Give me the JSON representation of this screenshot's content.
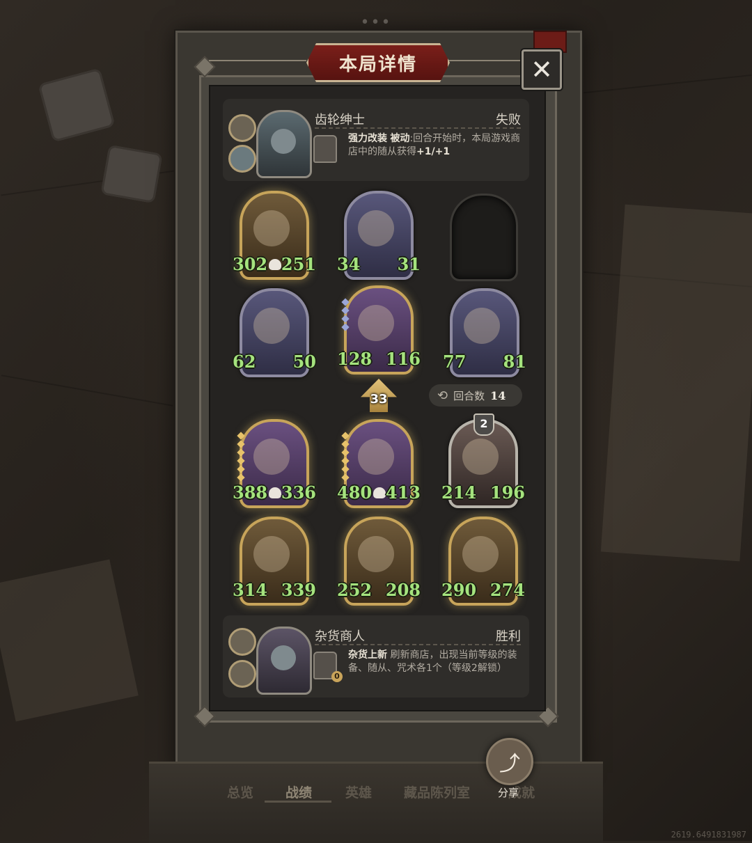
{
  "dialog": {
    "title": "本局详情",
    "close_label": "✕"
  },
  "opponent": {
    "name": "齿轮绅士",
    "result": "失败",
    "skill_name": "强力改装",
    "skill_type": "被动",
    "skill_desc": ":回合开始时，本局游戏商店中的随从获得",
    "skill_bonus": "+1/+1"
  },
  "board_top": {
    "rows": [
      [
        {
          "atk": "302",
          "hp": "251",
          "skull": true
        },
        {
          "atk": "34",
          "hp": "31",
          "skull": false
        },
        {
          "empty": true
        }
      ],
      [
        {
          "atk": "62",
          "hp": "50"
        },
        {
          "atk": "128",
          "hp": "116"
        },
        {
          "atk": "77",
          "hp": "81"
        }
      ]
    ]
  },
  "round": {
    "level": "33",
    "label": "回合数",
    "count": "14"
  },
  "board_bottom": {
    "rows": [
      [
        {
          "atk": "388",
          "hp": "336",
          "skull": true
        },
        {
          "atk": "480",
          "hp": "413",
          "skull": true
        },
        {
          "atk": "214",
          "hp": "196",
          "tier": "2"
        }
      ],
      [
        {
          "atk": "314",
          "hp": "339"
        },
        {
          "atk": "252",
          "hp": "208"
        },
        {
          "atk": "290",
          "hp": "274"
        }
      ]
    ]
  },
  "player": {
    "name": "杂货商人",
    "result": "胜利",
    "skill_name": "杂货上新",
    "skill_desc": "刷新商店，出现当前等级的装备、随从、咒术各1个（等级2解锁）",
    "skill_cost": "0"
  },
  "tabs": [
    "总览",
    "战绩",
    "英雄",
    "藏品陈列室",
    "成就"
  ],
  "share_label": "分享",
  "watermark": "2619.6491831987",
  "top_dots": "•••"
}
